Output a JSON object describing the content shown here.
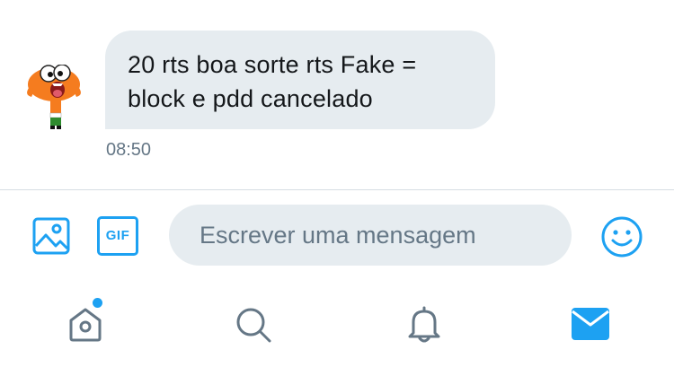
{
  "conversation": {
    "messages": [
      {
        "text": "20 rts boa sorte rts Fake =\nblock e pdd cancelado",
        "time": "08:50",
        "sender_avatar": "cartoon-avatar-orange-character"
      }
    ]
  },
  "composer": {
    "placeholder": "Escrever uma mensagem",
    "gif_label": "GIF",
    "icons": [
      "image-icon",
      "gif-icon",
      "emoji-icon"
    ]
  },
  "tabbar": {
    "tabs": [
      {
        "name": "home",
        "icon": "home-icon",
        "has_notification": true
      },
      {
        "name": "search",
        "icon": "search-icon",
        "active": false
      },
      {
        "name": "notifications",
        "icon": "bell-icon",
        "active": false
      },
      {
        "name": "messages",
        "icon": "mail-icon",
        "active": true
      }
    ]
  },
  "colors": {
    "accent": "#1da1f2",
    "bubble": "#e6ecf0",
    "icon_gray": "#657786",
    "text": "#14171a"
  }
}
